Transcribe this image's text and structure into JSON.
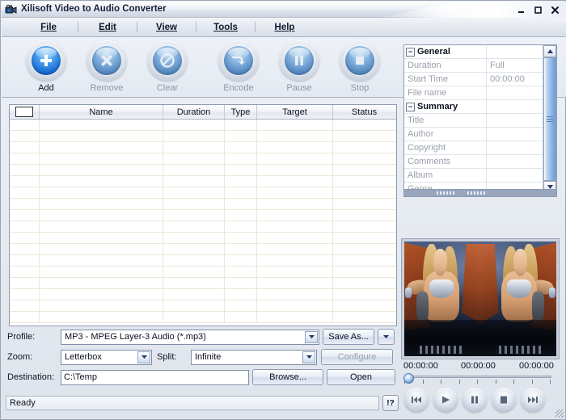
{
  "window": {
    "title": "Xilisoft Video to Audio Converter",
    "icon": "camcorder-icon",
    "controls": {
      "minimize": "–",
      "maximize": "□",
      "close": "✕"
    }
  },
  "menu": {
    "items": [
      {
        "label": "File",
        "accel": "F"
      },
      {
        "label": "Edit",
        "accel": "E"
      },
      {
        "label": "View",
        "accel": "V"
      },
      {
        "label": "Tools",
        "accel": "T"
      },
      {
        "label": "Help",
        "accel": "H"
      }
    ]
  },
  "toolbar": {
    "buttons": [
      {
        "label": "Add",
        "icon": "plus-icon",
        "glyph": "✚",
        "enabled": true
      },
      {
        "label": "Remove",
        "icon": "cross-icon",
        "glyph": "✖",
        "enabled": false
      },
      {
        "label": "Clear",
        "icon": "no-entry-icon",
        "glyph": "⃠",
        "enabled": false
      },
      {
        "label": "Encode",
        "icon": "arrow-convert-icon",
        "glyph": "↪",
        "enabled": false
      },
      {
        "label": "Pause",
        "icon": "pause-icon",
        "glyph": "Ⅱ",
        "enabled": false
      },
      {
        "label": "Stop",
        "icon": "stop-icon",
        "glyph": "■",
        "enabled": false
      }
    ]
  },
  "file_list": {
    "select_all_checked": false,
    "columns": [
      "",
      "Name",
      "Duration",
      "Type",
      "Target",
      "Status"
    ],
    "rows": []
  },
  "properties": {
    "rows": [
      {
        "group": true,
        "name": "General",
        "value": ""
      },
      {
        "group": false,
        "name": "Duration",
        "value": "Full"
      },
      {
        "group": false,
        "name": "Start Time",
        "value": "00:00:00"
      },
      {
        "group": false,
        "name": "File name",
        "value": ""
      },
      {
        "group": true,
        "name": "Summary",
        "value": ""
      },
      {
        "group": false,
        "name": "Title",
        "value": ""
      },
      {
        "group": false,
        "name": "Author",
        "value": ""
      },
      {
        "group": false,
        "name": "Copyright",
        "value": ""
      },
      {
        "group": false,
        "name": "Comments",
        "value": ""
      },
      {
        "group": false,
        "name": "Album",
        "value": ""
      },
      {
        "group": false,
        "name": "Genre",
        "value": ""
      }
    ],
    "expander_glyph": "−"
  },
  "settings": {
    "profile_label": "Profile:",
    "profile_value": "MP3 - MPEG Layer-3 Audio  (*.mp3)",
    "save_as_label": "Save As...",
    "zoom_label": "Zoom:",
    "zoom_value": "Letterbox",
    "split_label": "Split:",
    "split_value": "Infinite",
    "configure_label": "Configure",
    "configure_enabled": false,
    "destination_label": "Destination:",
    "destination_value": "C:\\Temp",
    "browse_label": "Browse...",
    "open_label": "Open"
  },
  "status": {
    "text": "Ready",
    "help_label": "!?"
  },
  "player": {
    "time_current": "00:00:00",
    "time_selection": "00:00:00",
    "time_total": "00:00:00",
    "seek_position_percent": 0,
    "tick_count": 9,
    "buttons": [
      {
        "name": "previous",
        "glyph": "⏮"
      },
      {
        "name": "play",
        "glyph": "▶"
      },
      {
        "name": "pause",
        "glyph": "⏸"
      },
      {
        "name": "stop",
        "glyph": "■"
      },
      {
        "name": "next",
        "glyph": "⏭"
      }
    ]
  },
  "colors": {
    "window_bg": "#dfe4ec",
    "accent_blue": "#1668cf",
    "titlebar_text": "#16203a",
    "disabled_text": "#9aa1ae",
    "list_bg": "#ffffff",
    "grid_line": "#ece7d8"
  }
}
